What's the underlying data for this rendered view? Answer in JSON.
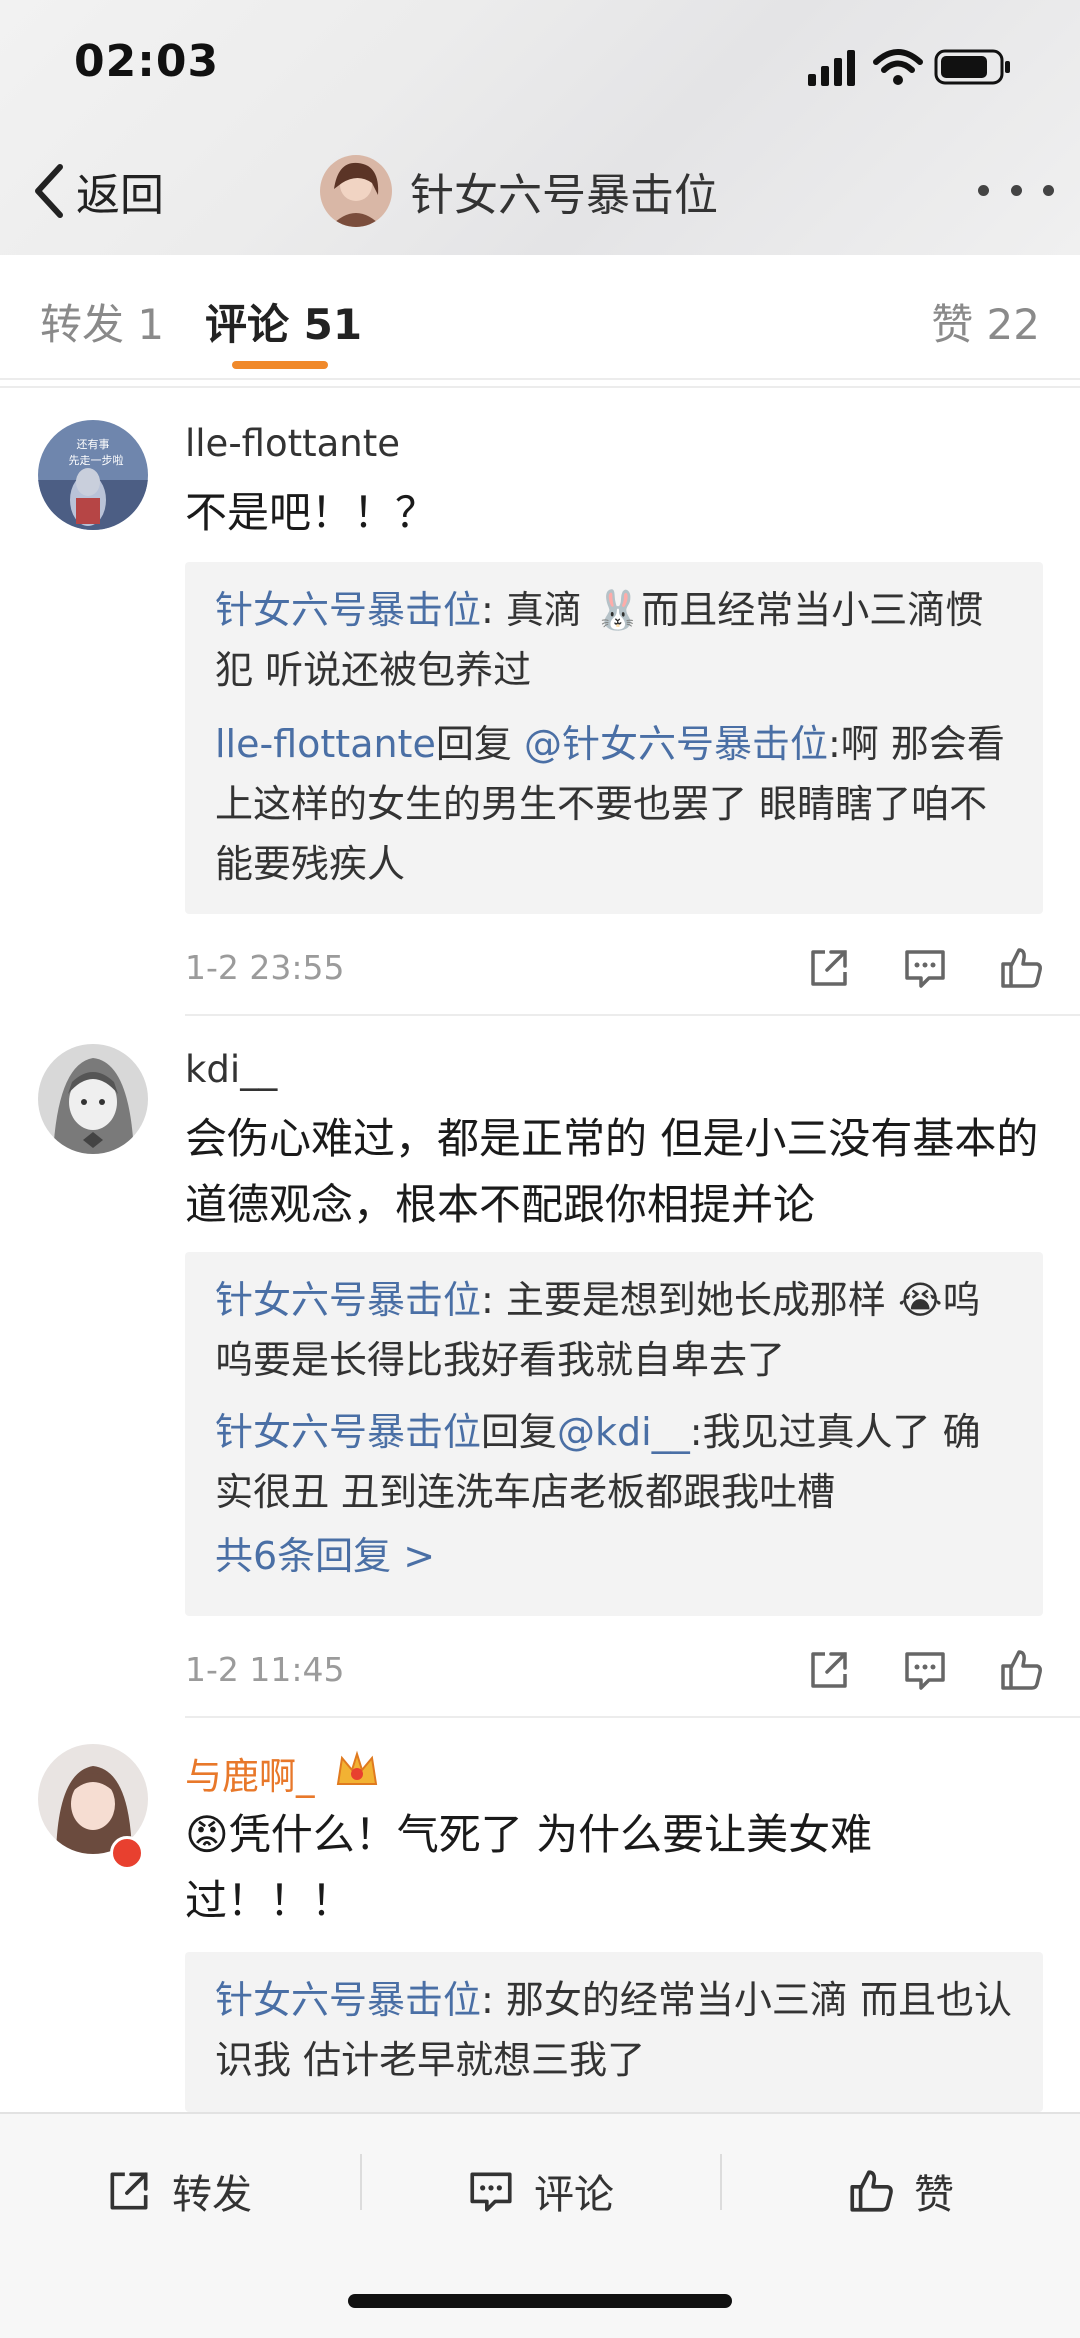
{
  "status_bar": {
    "time": "02:03",
    "icons": [
      "cellular-signal-icon",
      "wifi-icon",
      "battery-icon"
    ]
  },
  "nav": {
    "back_label": "返回",
    "title": "针女六号暴击位",
    "more_icon": "more-dots-icon"
  },
  "tabs": {
    "repost": "转发 1",
    "comment": "评论 51",
    "like": "赞 22",
    "active": "comment",
    "accent": "#f0892a"
  },
  "comments": [
    {
      "user": "lle-flottante",
      "avatar_text": [
        "还有事",
        "先走一步啦"
      ],
      "text": "不是吧！！？",
      "replies": [
        {
          "name": "针女六号暴击位",
          "text": ": 真滴 🐰而且经常当小三滴惯犯 听说还被包养过"
        },
        {
          "name": "lle-flottante",
          "reply_word": "回复",
          "target": "@针女六号暴击位",
          "text": ":啊 那会看上这样的女生的男生不要也罢了 眼睛瞎了咱不能要残疾人"
        }
      ],
      "time": "1-2 23:55"
    },
    {
      "user": "kdi__",
      "text": "会伤心难过，都是正常的 但是小三没有基本的道德观念，根本不配跟你相提并论",
      "replies": [
        {
          "name": "针女六号暴击位",
          "text": ": 主要是想到她长成那样 😭呜呜要是长得比我好看我就自卑去了"
        },
        {
          "name": "针女六号暴击位",
          "reply_word": "回复",
          "target": "@kdi__",
          "text": ":我见过真人了 确实很丑 丑到连洗车店老板都跟我吐槽"
        }
      ],
      "more_replies": "共6条回复 >",
      "time": "1-2 11:45"
    },
    {
      "user": "与鹿啊_",
      "user_color": "#e8782a",
      "badge_icon": "vip-crown-icon",
      "text": "😡凭什么！气死了 为什么要让美女难过！！！",
      "replies": [
        {
          "name": "针女六号暴击位",
          "text": ": 那女的经常当小三滴 而且也认识我 估计老早就想三我了"
        }
      ]
    }
  ],
  "bottom_bar": {
    "repost": "转发",
    "comment": "评论",
    "like": "赞"
  },
  "colors": {
    "link_blue": "#4a6fa5",
    "quote_bg": "#f3f3f3",
    "meta_gray": "#9b9b9b"
  }
}
